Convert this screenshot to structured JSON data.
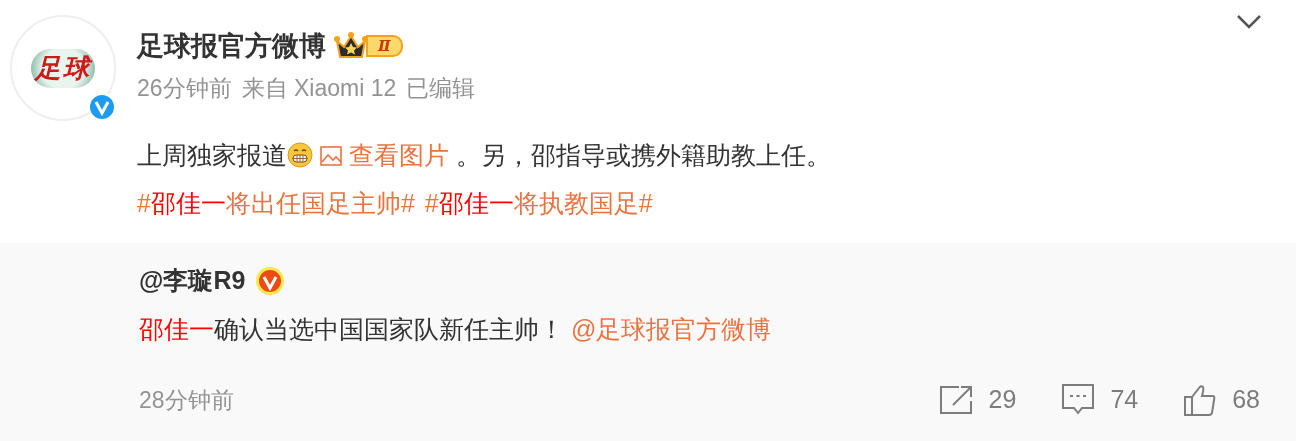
{
  "post": {
    "author": "足球报官方微博",
    "avatar_text": "足球",
    "verified": true,
    "badge_level": "Ⅱ",
    "meta": {
      "time": "26分钟前",
      "source": "来自 Xiaomi 12",
      "edited": "已编辑"
    },
    "content": [
      {
        "kind": "text",
        "text": "上周独家报道"
      },
      {
        "kind": "emoji"
      },
      {
        "kind": "image_link",
        "text": "查看图片"
      },
      {
        "kind": "text",
        "text": " 。另，邵指导或携外籍助教上任。 "
      },
      {
        "kind": "topic",
        "parts": [
          {
            "kind": "plain",
            "text": "#"
          },
          {
            "kind": "name",
            "text": "邵佳一"
          },
          {
            "kind": "plain",
            "text": "将出任国足主帅#"
          }
        ]
      },
      {
        "kind": "topic",
        "parts": [
          {
            "kind": "plain",
            "text": "#"
          },
          {
            "kind": "name",
            "text": "邵佳一"
          },
          {
            "kind": "plain",
            "text": "将执教国足#"
          }
        ]
      }
    ]
  },
  "repost": {
    "author": "@李璇R9",
    "verified": true,
    "content": [
      {
        "kind": "name",
        "text": "邵佳一"
      },
      {
        "kind": "text",
        "text": "确认当选中国国家队新任主帅！ "
      },
      {
        "kind": "mention",
        "text": "@足球报官方微博"
      }
    ],
    "time": "28分钟前",
    "actions": [
      {
        "kind": "share",
        "count": "29"
      },
      {
        "kind": "comment",
        "count": "74"
      },
      {
        "kind": "like",
        "count": "68"
      }
    ]
  }
}
